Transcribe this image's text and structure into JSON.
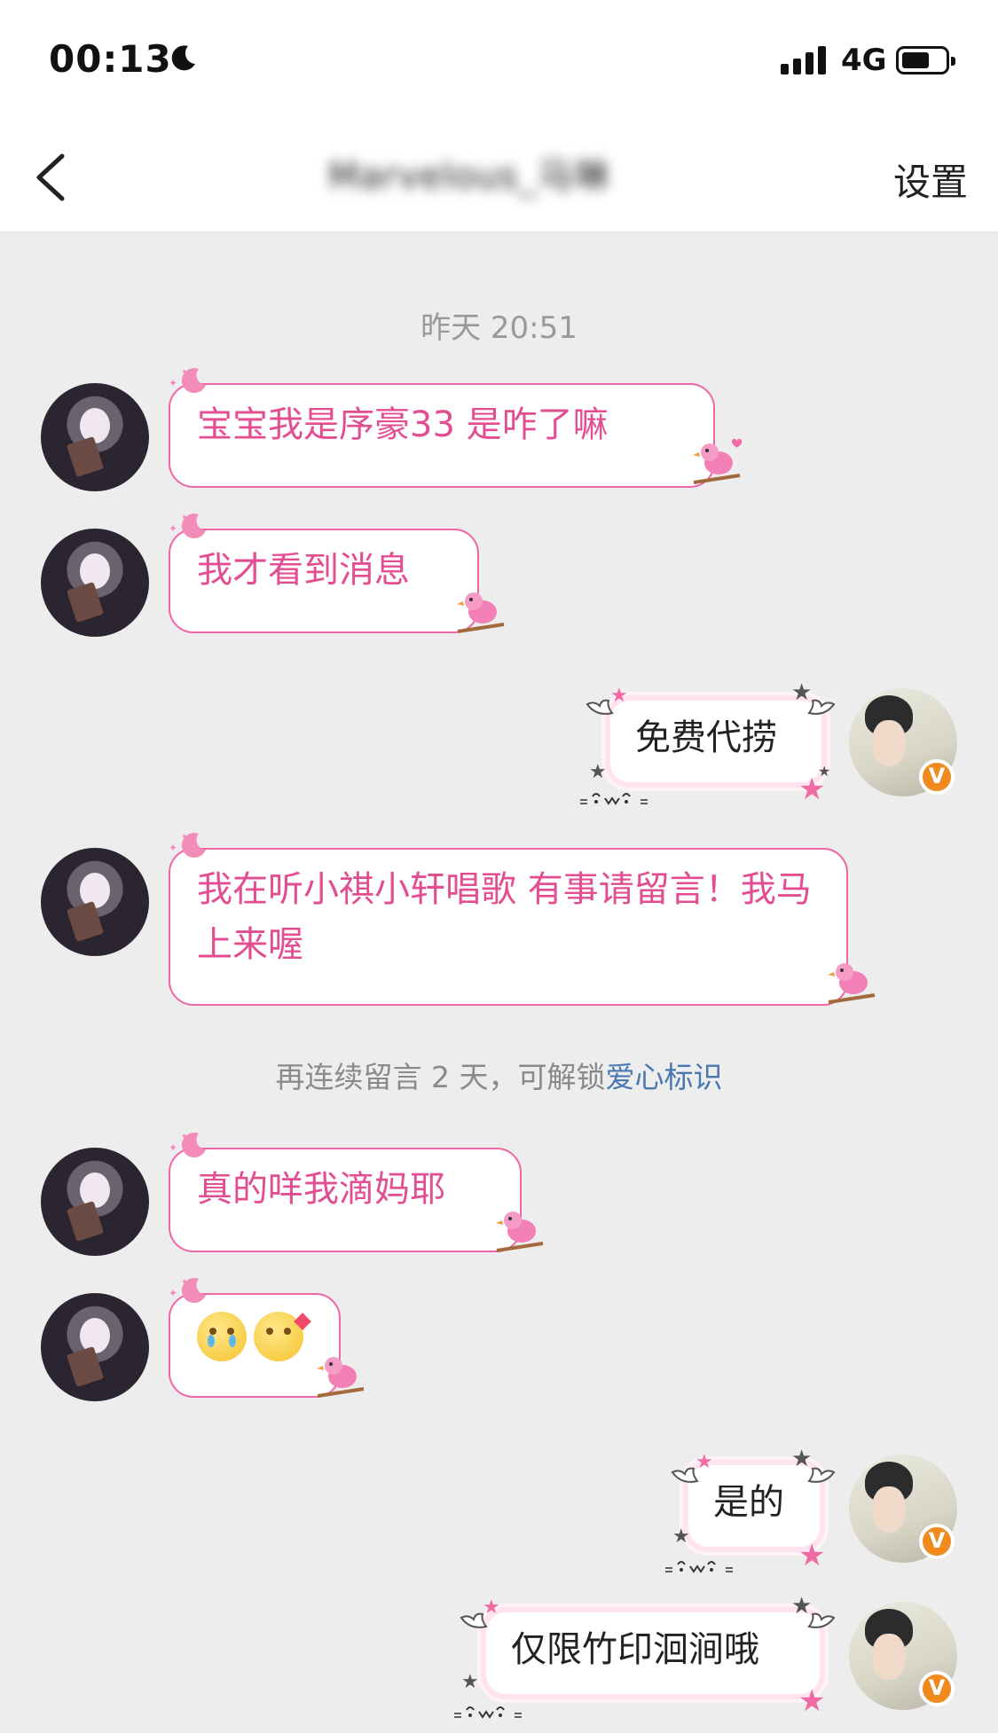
{
  "status": {
    "time": "00:13",
    "network": "4G",
    "icons": [
      "moon-icon",
      "signal-icon",
      "battery-icon"
    ]
  },
  "nav": {
    "back_icon": "chevron-left-icon",
    "title": "Marvelous_马琳",
    "settings_label": "设置"
  },
  "timestamp": "昨天 20:51",
  "notice": {
    "prefix": "再连续留言 2 天，可解锁",
    "link": "爱心标识"
  },
  "messages": [
    {
      "side": "left",
      "text": "宝宝我是序豪33 是咋了嘛"
    },
    {
      "side": "left",
      "text": "我才看到消息"
    },
    {
      "side": "right",
      "text": "免费代捞"
    },
    {
      "side": "left",
      "text": "我在听小祺小轩唱歌 有事请留言！我马上来喔"
    },
    {
      "side": "left",
      "text": "真的咩我滴妈耶"
    },
    {
      "side": "left",
      "text": "",
      "emojis": [
        "crying-emoji",
        "heart-eyes-emoji"
      ]
    },
    {
      "side": "right",
      "text": "是的"
    },
    {
      "side": "right",
      "text": "仅限竹印洄涧哦"
    }
  ],
  "badge": {
    "label": "V",
    "color": "#f08a1e"
  },
  "colors": {
    "accent_pink": "#e34d92",
    "link_blue": "#4a78b0"
  }
}
